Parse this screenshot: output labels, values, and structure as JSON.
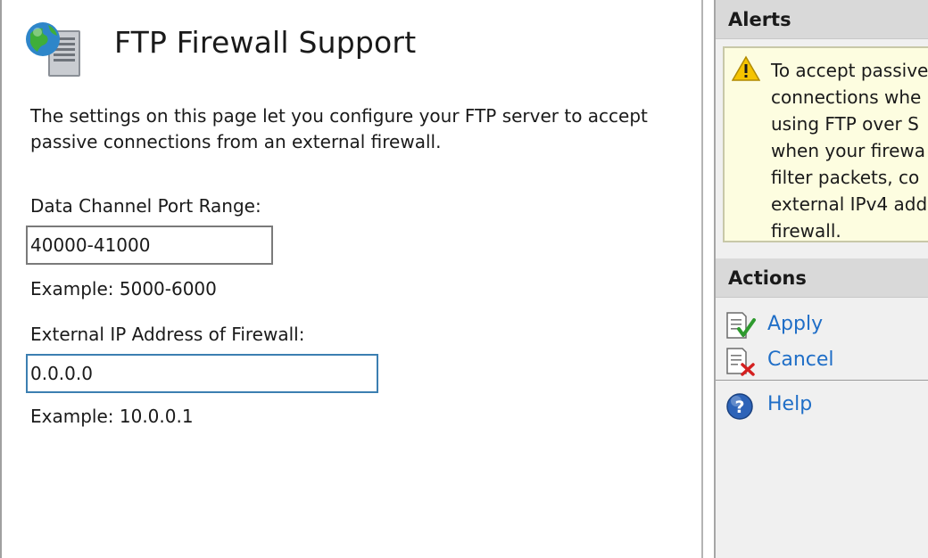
{
  "header": {
    "title": "FTP Firewall Support",
    "icon": "ftp-server-globe-icon"
  },
  "main": {
    "description": "The settings on this page let you configure your FTP server to accept passive connections from an external firewall.",
    "port_range": {
      "label": "Data Channel Port Range:",
      "value": "40000-41000",
      "example": "Example: 5000-6000"
    },
    "external_ip": {
      "label": "External IP Address of Firewall:",
      "value": "0.0.0.0",
      "example": "Example: 10.0.0.1"
    }
  },
  "alerts": {
    "title": "Alerts",
    "icon": "warning-icon",
    "lines": [
      "To accept passive",
      "connections whe",
      "using FTP over S",
      "when your firewa",
      "filter packets, co",
      "external IPv4 add",
      "firewall."
    ]
  },
  "actions": {
    "title": "Actions",
    "items": [
      {
        "label": "Apply",
        "icon": "apply-icon"
      },
      {
        "label": "Cancel",
        "icon": "cancel-icon"
      },
      {
        "label": "Help",
        "icon": "help-icon"
      }
    ]
  },
  "colors": {
    "link": "#1f6ec7",
    "alert_bg": "#fdfde0",
    "header_bg": "#d9d9d9",
    "focus_border": "#3c7fb1"
  }
}
